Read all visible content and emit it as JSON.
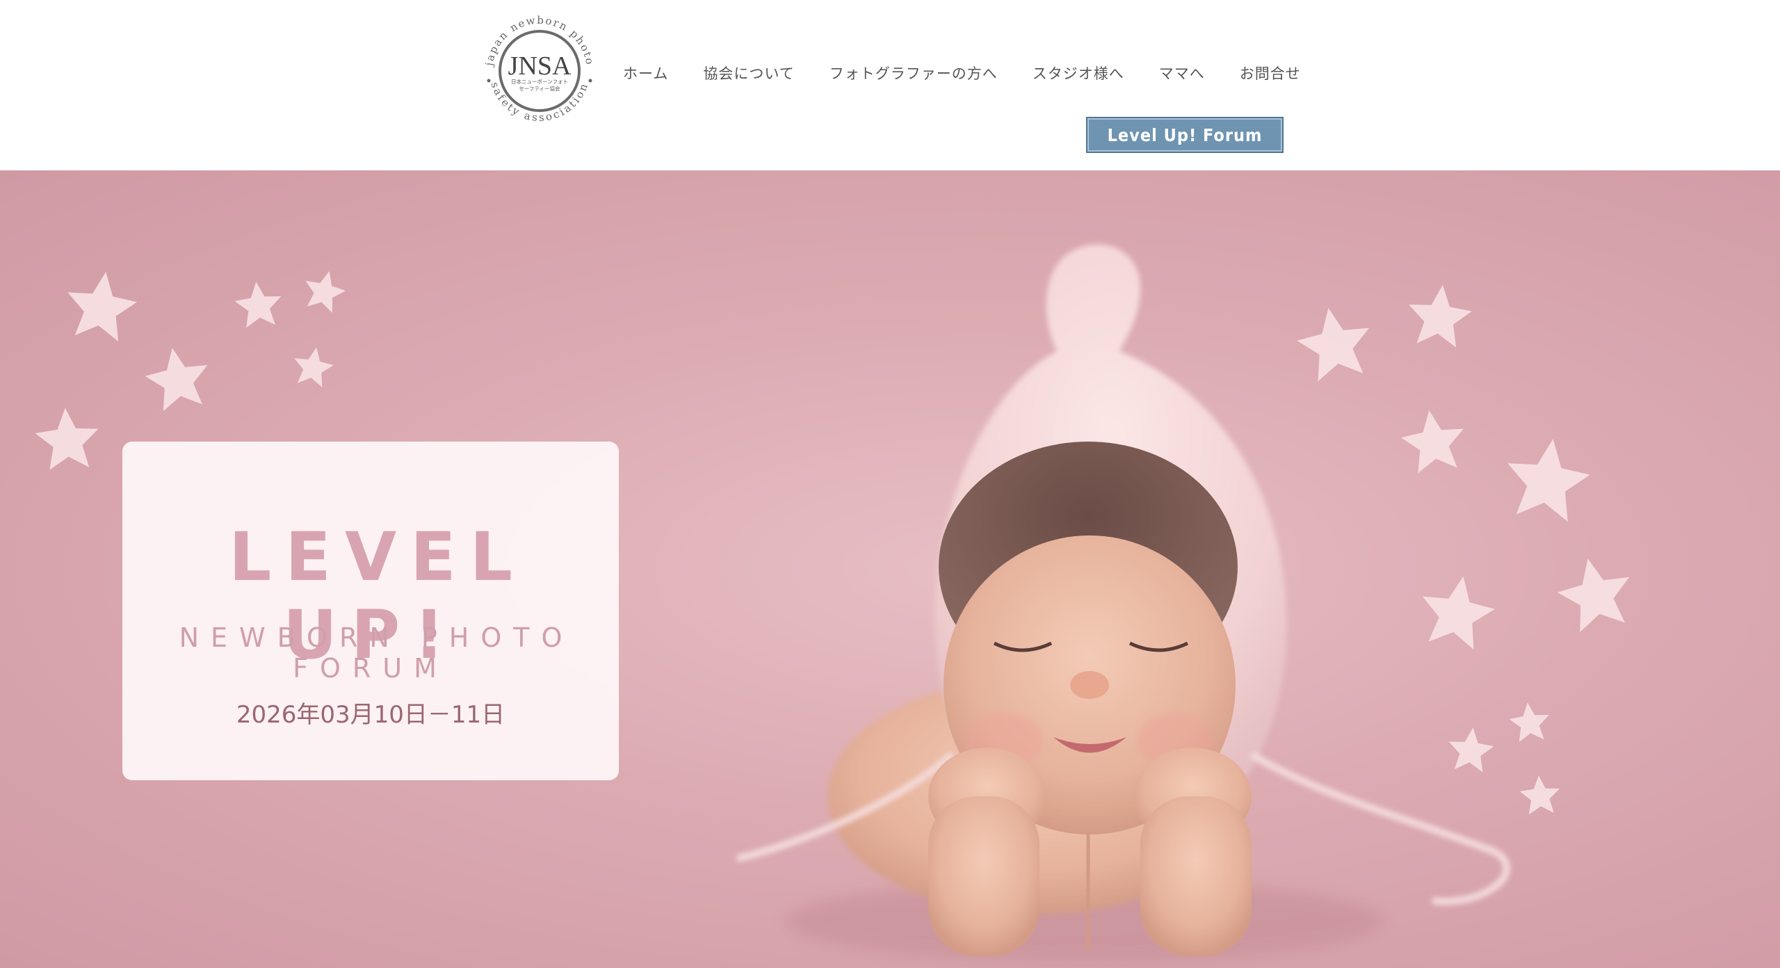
{
  "logo": {
    "abbr": "JNSA",
    "jp_line1": "日本ニューボーンフォト",
    "jp_line2": "セーフティー協会",
    "ring_top": "japan newborn photo",
    "ring_bottom": "safety association"
  },
  "nav": {
    "items": [
      {
        "label": "ホーム"
      },
      {
        "label": "協会について"
      },
      {
        "label": "フォトグラファーの方へ"
      },
      {
        "label": "スタジオ様へ"
      },
      {
        "label": "ママへ"
      },
      {
        "label": "お問合せ"
      }
    ],
    "forum_button": "Level Up! Forum"
  },
  "hero": {
    "title": "LEVEL UP!",
    "subtitle": "NEWBORN PHOTO FORUM",
    "date": "2026年03月10日－11日"
  },
  "colors": {
    "hero_bg": "#dcabb2",
    "title_pink": "#d9a4b2",
    "button_blue": "#6f94b2",
    "star": "#f7dfe2"
  }
}
